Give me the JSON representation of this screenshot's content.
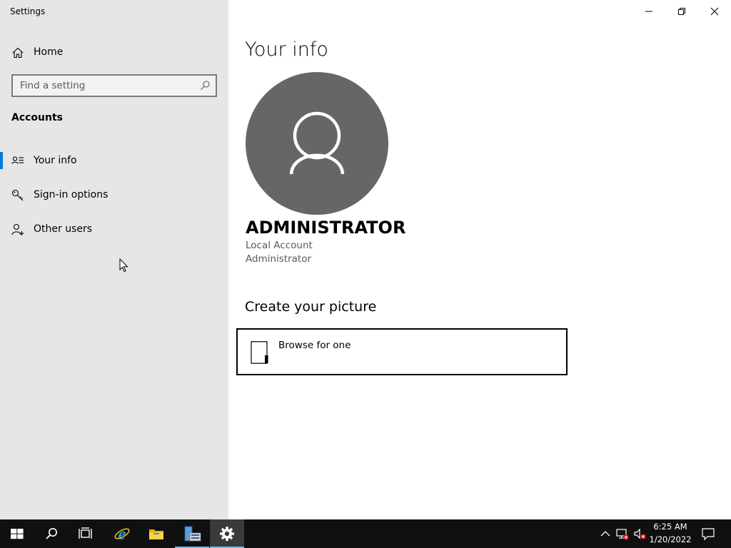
{
  "window": {
    "title": "Settings",
    "controls": {
      "minimize": "minimize-icon",
      "restore": "restore-icon",
      "close": "close-icon"
    }
  },
  "sidebar": {
    "home_label": "Home",
    "search": {
      "placeholder": "Find a setting",
      "value": ""
    },
    "section_heading": "Accounts",
    "items": [
      {
        "label": "Your info",
        "icon": "contact-card-icon",
        "active": true
      },
      {
        "label": "Sign-in options",
        "icon": "key-icon",
        "active": false
      },
      {
        "label": "Other users",
        "icon": "add-person-icon",
        "active": false
      }
    ]
  },
  "main": {
    "title": "Your info",
    "account": {
      "name": "ADMINISTRATOR",
      "type": "Local Account",
      "role": "Administrator"
    },
    "create_picture": {
      "heading": "Create your picture",
      "browse_label": "Browse for one"
    }
  },
  "taskbar": {
    "apps": [
      "start-icon",
      "search-icon",
      "task-view-icon",
      "internet-explorer-icon",
      "file-explorer-icon",
      "server-manager-icon",
      "settings-gear-icon"
    ],
    "clock": {
      "time": "6:25 AM",
      "date": "1/20/2022"
    }
  },
  "colors": {
    "sidebar_bg": "#e6e6e6",
    "accent": "#0078d7",
    "avatar_bg": "#666666",
    "taskbar_bg": "#101010"
  }
}
